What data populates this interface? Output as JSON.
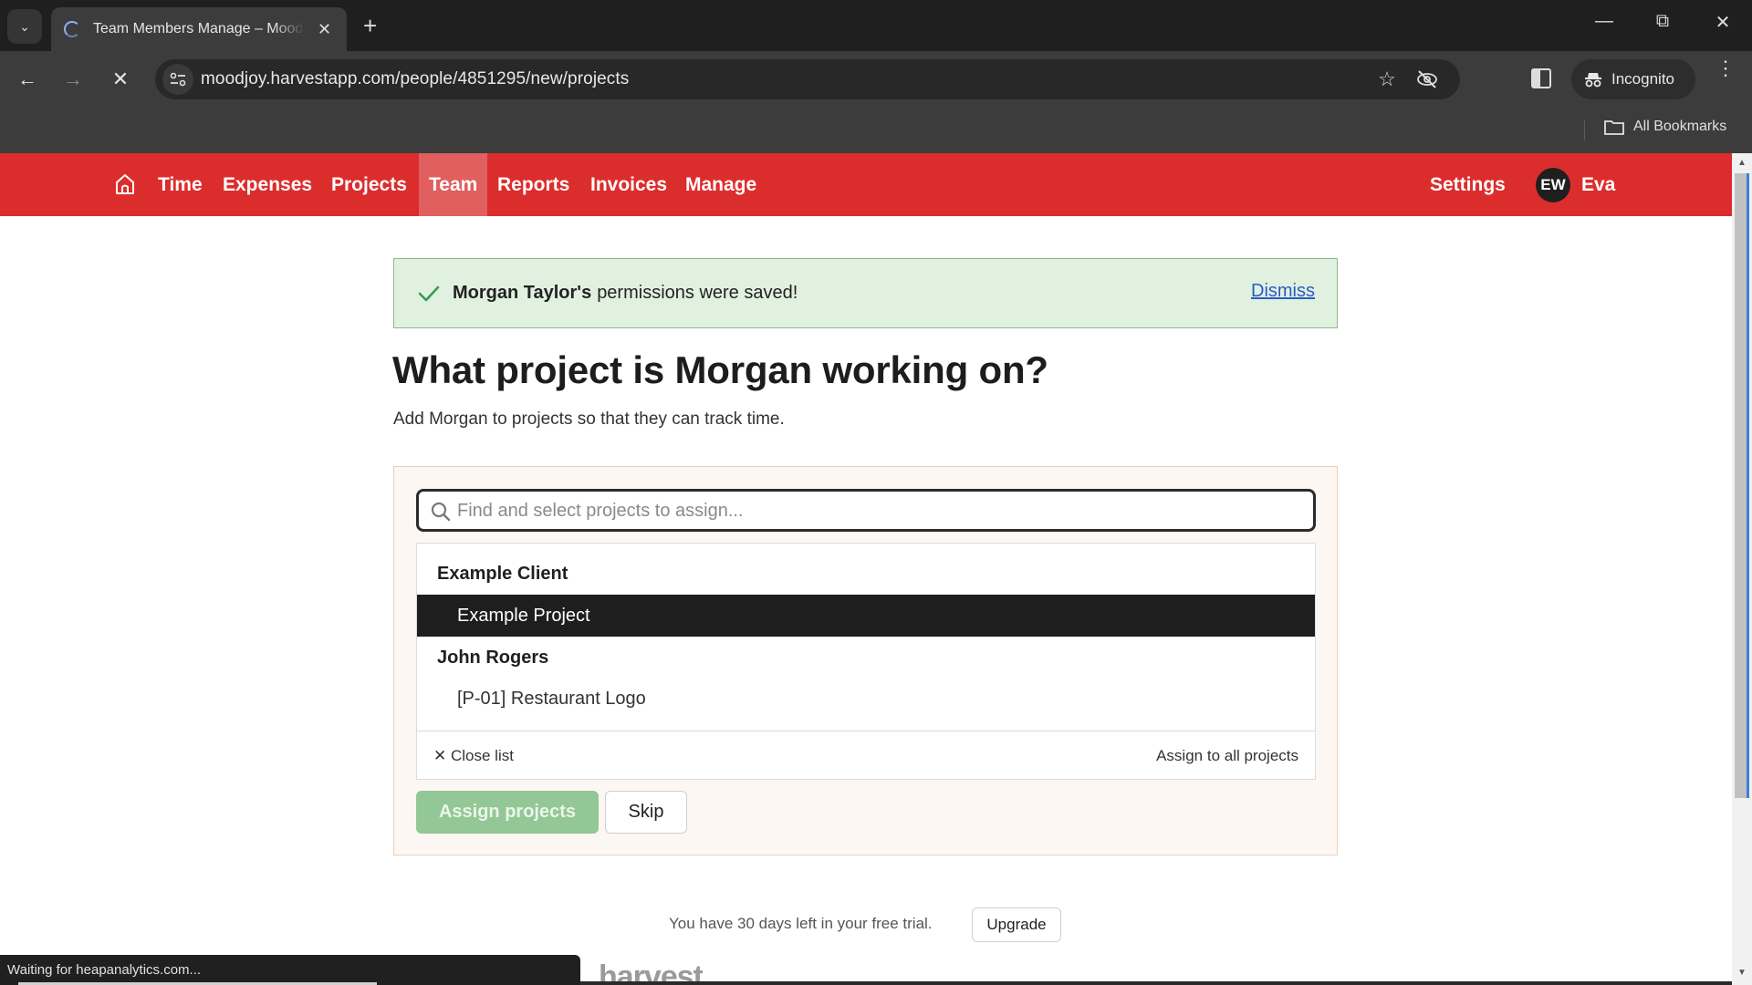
{
  "browser": {
    "tab_title": "Team Members Manage – Moodjoy",
    "url": "moodjoy.harvestapp.com/people/4851295/new/projects",
    "profile_label": "Incognito",
    "bookmarks_label": "All Bookmarks",
    "status_text": "Waiting for heapanalytics.com..."
  },
  "nav": {
    "items": [
      {
        "label": "Time",
        "active": false
      },
      {
        "label": "Expenses",
        "active": false
      },
      {
        "label": "Projects",
        "active": false
      },
      {
        "label": "Team",
        "active": true
      },
      {
        "label": "Reports",
        "active": false
      },
      {
        "label": "Invoices",
        "active": false
      },
      {
        "label": "Manage",
        "active": false
      }
    ],
    "settings_label": "Settings",
    "avatar_initials": "EW",
    "user_name": "Eva",
    "brand_color": "#dc2d2d"
  },
  "notice": {
    "name": "Morgan Taylor's",
    "message": "permissions were saved!",
    "dismiss_label": "Dismiss"
  },
  "page": {
    "title": "What project is Morgan working on?",
    "subtitle": "Add Morgan to projects so that they can track time."
  },
  "assign": {
    "search_placeholder": "Find and select projects to assign...",
    "search_value": "",
    "groups": [
      {
        "client": "Example Client",
        "projects": [
          {
            "name": "Example Project",
            "highlighted": true
          }
        ]
      },
      {
        "client": "John Rogers",
        "projects": [
          {
            "name": "[P-01] Restaurant Logo",
            "highlighted": false
          }
        ]
      }
    ],
    "close_list_label": "Close list",
    "assign_all_label": "Assign to all projects",
    "assign_button_label": "Assign projects",
    "skip_button_label": "Skip"
  },
  "trial": {
    "text": "You have 30 days left in your free trial.",
    "upgrade_label": "Upgrade"
  },
  "footer": {
    "logo_text": "harvest"
  }
}
